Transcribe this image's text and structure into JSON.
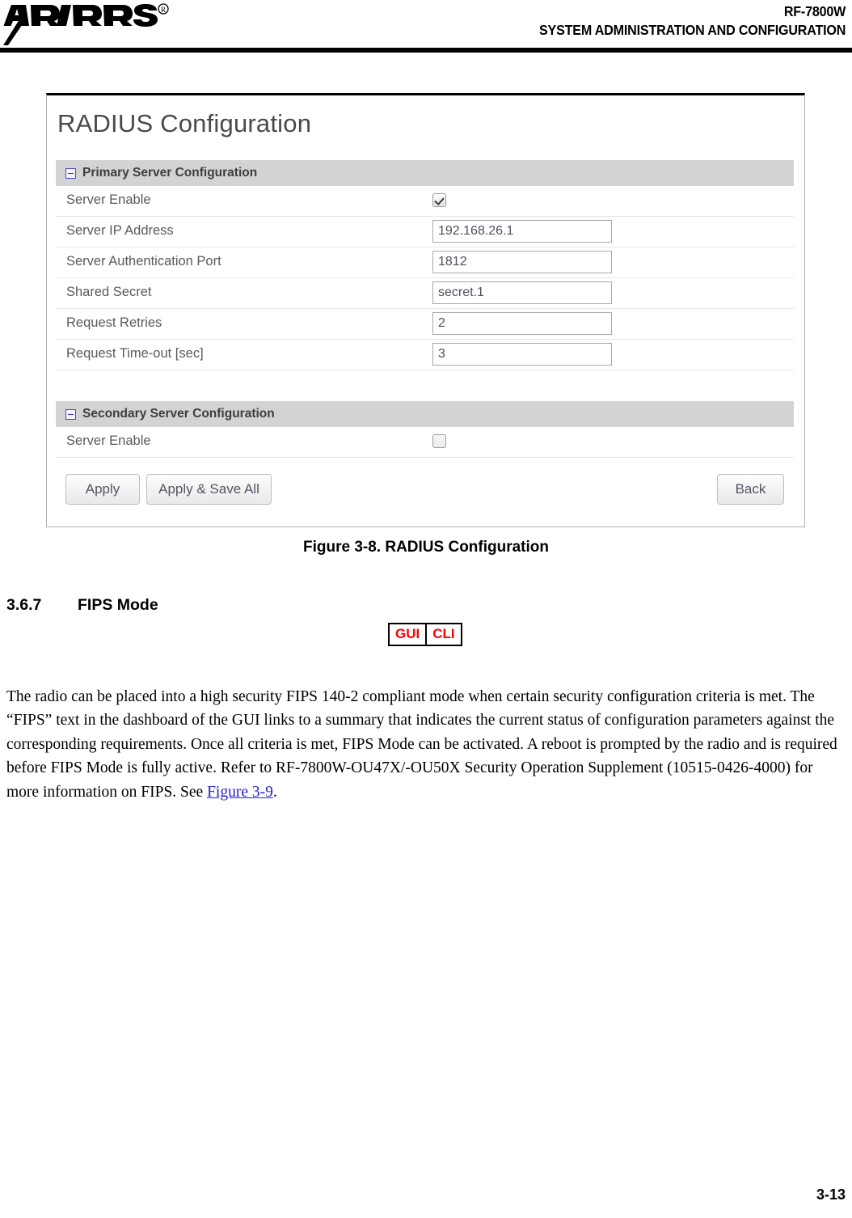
{
  "header": {
    "logo_text": "HARRIS",
    "logo_mark": "registered-trademark",
    "product": "RF-7800W",
    "manual_title": "SYSTEM ADMINISTRATION AND CONFIGURATION"
  },
  "figure": {
    "gui_title": "RADIUS Configuration",
    "sections": [
      {
        "id": "primary",
        "label": "Primary Server Configuration",
        "collapse_icon": "minus-square-icon",
        "rows": [
          {
            "label": "Server Enable",
            "type": "checkbox",
            "checked": true
          },
          {
            "label": "Server IP Address",
            "type": "text",
            "value": "192.168.26.1"
          },
          {
            "label": "Server Authentication Port",
            "type": "text",
            "value": "1812"
          },
          {
            "label": "Shared Secret",
            "type": "text",
            "value": "secret.1"
          },
          {
            "label": "Request Retries",
            "type": "text",
            "value": "2"
          },
          {
            "label": "Request Time-out [sec]",
            "type": "text",
            "value": "3"
          }
        ]
      },
      {
        "id": "secondary",
        "label": "Secondary Server Configuration",
        "collapse_icon": "minus-square-icon",
        "rows": [
          {
            "label": "Server Enable",
            "type": "checkbox",
            "checked": false
          }
        ]
      }
    ],
    "buttons": {
      "apply": "Apply",
      "apply_save_all": "Apply & Save All",
      "back": "Back"
    },
    "caption": "Figure 3-8.  RADIUS Configuration"
  },
  "section": {
    "number": "3.6.7",
    "title": "FIPS Mode",
    "badge": {
      "gui": "GUI",
      "cli": "CLI",
      "color": "#ff0000"
    }
  },
  "body": {
    "part1": "The radio can be placed into a high security FIPS 140-2 compliant mode when certain security configuration criteria is met. The “FIPS” text in the dashboard of the GUI links to a summary that indicates the current status of configuration parameters against the corresponding requirements. Once all criteria is met, FIPS Mode can be activated. A reboot is prompted by the radio and is required before FIPS Mode is fully active. Refer to RF-7800W-OU47X/-OU50X Security Operation Supplement (10515-0426-4000) for more information on FIPS. See ",
    "xref": "Figure 3-9",
    "part2": "."
  },
  "footer": {
    "page_number": "3-13"
  }
}
